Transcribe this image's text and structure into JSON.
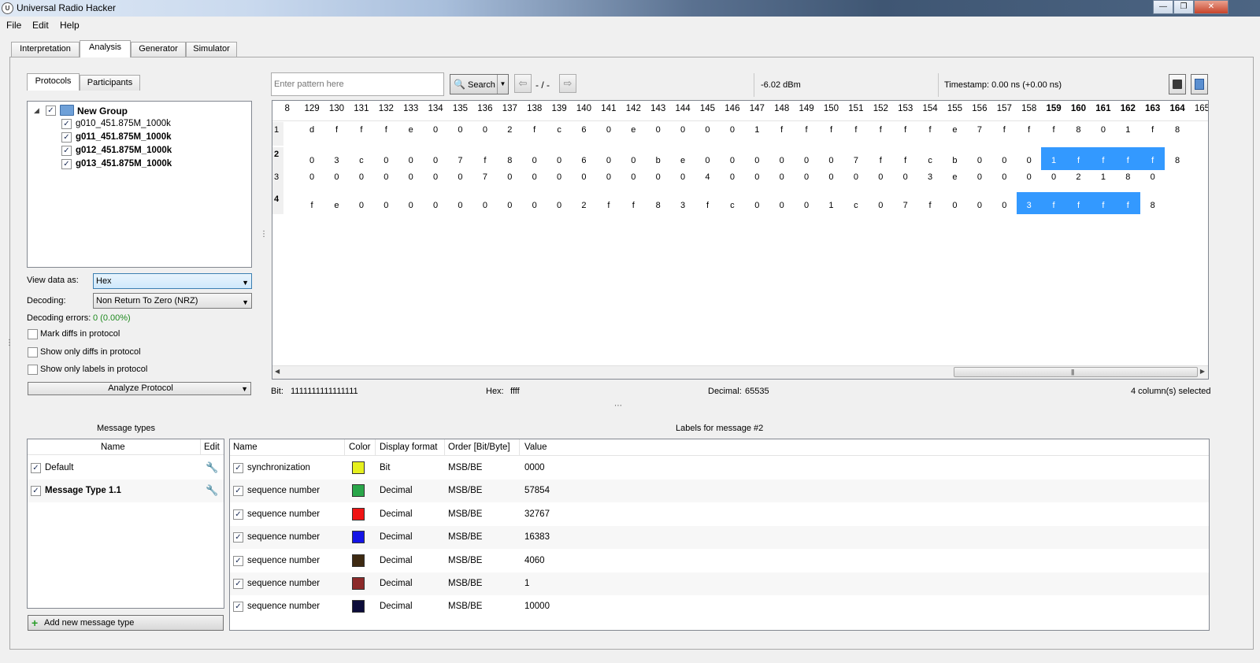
{
  "window": {
    "title": "Universal Radio Hacker"
  },
  "menu": [
    "File",
    "Edit",
    "Help"
  ],
  "main_tabs": [
    "Interpretation",
    "Analysis",
    "Generator",
    "Simulator"
  ],
  "sub_tabs": [
    "Protocols",
    "Participants"
  ],
  "tree": {
    "group": "New Group",
    "items": [
      "g010_451.875M_1000k",
      "g011_451.875M_1000k",
      "g012_451.875M_1000k",
      "g013_451.875M_1000k"
    ]
  },
  "options": {
    "view_label": "View data as:",
    "view_value": "Hex",
    "decoding_label": "Decoding:",
    "decoding_value": "Non Return To Zero (NRZ)",
    "errors_label": "Decoding errors:",
    "errors_value": "0 (0.00%)",
    "mark_diffs": "Mark diffs in protocol",
    "show_diffs": "Show only diffs in protocol",
    "show_labels": "Show only labels in protocol",
    "analyze": "Analyze Protocol"
  },
  "search": {
    "placeholder": "Enter pattern here",
    "button": "Search",
    "position": "- / -",
    "rssi": "-6.02 dBm",
    "timestamp": "Timestamp:  0.00 ns (+0.00 ns)"
  },
  "table": {
    "columns": [
      "8",
      "129",
      "130",
      "131",
      "132",
      "133",
      "134",
      "135",
      "136",
      "137",
      "138",
      "139",
      "140",
      "141",
      "142",
      "143",
      "144",
      "145",
      "146",
      "147",
      "148",
      "149",
      "150",
      "151",
      "152",
      "153",
      "154",
      "155",
      "156",
      "157",
      "158",
      "159",
      "160",
      "161",
      "162",
      "163",
      "164",
      "165"
    ],
    "bold_columns": [
      "159",
      "160",
      "161",
      "162",
      "163",
      "164"
    ],
    "rows": [
      {
        "num": "1",
        "cells": [
          "d",
          "f",
          "f",
          "f",
          "e",
          "0",
          "0",
          "0",
          "2",
          "f",
          "c",
          "6",
          "0",
          "e",
          "0",
          "0",
          "0",
          "0",
          "1",
          "f",
          "f",
          "f",
          "f",
          "f",
          "f",
          "f",
          "e",
          "7",
          "f",
          "f",
          "f",
          "8",
          "0",
          "1",
          "f",
          "8"
        ]
      },
      {
        "num": "2",
        "cells": [
          "0",
          "3",
          "c",
          "0",
          "0",
          "0",
          "7",
          "f",
          "8",
          "0",
          "0",
          "6",
          "0",
          "0",
          "b",
          "e",
          "0",
          "0",
          "0",
          "0",
          "0",
          "0",
          "7",
          "f",
          "f",
          "c",
          "b",
          "0",
          "0",
          "0",
          "1",
          "f",
          "f",
          "f",
          "f",
          "8"
        ]
      },
      {
        "num": "3",
        "cells": [
          "0",
          "0",
          "0",
          "0",
          "0",
          "0",
          "0",
          "7",
          "0",
          "0",
          "0",
          "0",
          "0",
          "0",
          "0",
          "0",
          "4",
          "0",
          "0",
          "0",
          "0",
          "0",
          "0",
          "0",
          "0",
          "3",
          "e",
          "0",
          "0",
          "0",
          "0",
          "2",
          "1",
          "8",
          "0",
          ""
        ]
      },
      {
        "num": "4",
        "cells": [
          "f",
          "e",
          "0",
          "0",
          "0",
          "0",
          "0",
          "0",
          "0",
          "0",
          "0",
          "2",
          "f",
          "f",
          "8",
          "3",
          "f",
          "c",
          "0",
          "0",
          "0",
          "1",
          "c",
          "0",
          "7",
          "f",
          "0",
          "0",
          "0",
          "3",
          "f",
          "f",
          "f",
          "f",
          "8",
          ""
        ]
      }
    ]
  },
  "status": {
    "bit_label": "Bit:",
    "bit_value": "1111111111111111",
    "hex_label": "Hex:",
    "hex_value": "ffff",
    "dec_label": "Decimal:",
    "dec_value": "65535",
    "selected": "4 column(s) selected"
  },
  "message_types": {
    "title": "Message types",
    "col_name": "Name",
    "col_edit": "Edit",
    "items": [
      "Default",
      "Message Type 1.1"
    ],
    "add_button": "Add new message type"
  },
  "labels": {
    "title": "Labels for message #2",
    "headers": [
      "Name",
      "Color",
      "Display format",
      "Order [Bit/Byte]",
      "Value"
    ],
    "rows": [
      {
        "name": "synchronization",
        "color": "#e6f01e",
        "format": "Bit",
        "order": "MSB/BE",
        "value": "0000"
      },
      {
        "name": "sequence number",
        "color": "#2aa64a",
        "format": "Decimal",
        "order": "MSB/BE",
        "value": "57854"
      },
      {
        "name": "sequence number",
        "color": "#f01414",
        "format": "Decimal",
        "order": "MSB/BE",
        "value": "32767"
      },
      {
        "name": "sequence number",
        "color": "#1414e6",
        "format": "Decimal",
        "order": "MSB/BE",
        "value": "16383"
      },
      {
        "name": "sequence number",
        "color": "#3e2a12",
        "format": "Decimal",
        "order": "MSB/BE",
        "value": "4060"
      },
      {
        "name": "sequence number",
        "color": "#8c2a2a",
        "format": "Decimal",
        "order": "MSB/BE",
        "value": "1"
      },
      {
        "name": "sequence number",
        "color": "#0c0c3a",
        "format": "Decimal",
        "order": "MSB/BE",
        "value": "10000"
      }
    ]
  }
}
